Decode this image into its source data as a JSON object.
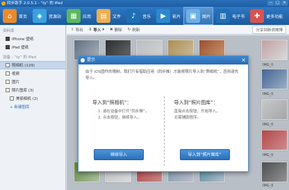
{
  "window": {
    "title": "同步助手 2.0.5.1 - “ty” 的 iPad",
    "buttons": [
      "—",
      "□",
      "✕"
    ]
  },
  "nav": {
    "items": [
      {
        "label": "首页",
        "icon": "home-icon",
        "color": "#e98a2e"
      },
      {
        "label": "资源站",
        "icon": "resource-icon",
        "color": "#3aa0e0"
      },
      {
        "label": "应用",
        "icon": "app-icon",
        "color": "#5cb85c"
      },
      {
        "label": "文件",
        "icon": "file-icon",
        "color": "#f0ad4e"
      },
      {
        "label": "音乐",
        "icon": "music-icon",
        "color": "#1f6fb5"
      },
      {
        "label": "影片",
        "icon": "video-icon",
        "color": "#2c89cf"
      },
      {
        "label": "图片",
        "icon": "picture-icon",
        "color": "#6bb0e6",
        "active": true
      },
      {
        "label": "电子书",
        "icon": "ebook-icon",
        "color": "#1f6fb5"
      },
      {
        "label": "更多功能",
        "icon": "more-icon",
        "color": "#d9534f"
      }
    ]
  },
  "sidebar": {
    "local_heading": "资料库",
    "local_items": [
      {
        "label": "iPhone 壁纸"
      },
      {
        "label": "iPad 壁纸"
      }
    ],
    "device_heading": "设备 - “ty” 的 iPad",
    "device_items": [
      {
        "label": "照相机 (129)",
        "selected": true
      },
      {
        "label": "视频"
      },
      {
        "label": "图片"
      },
      {
        "label": "照片图库 (3)"
      },
      {
        "label": "美丽相机 (2)",
        "sub": true
      },
      {
        "label": "+ 新建图库",
        "link": true,
        "sub": true
      }
    ]
  },
  "toolbar": {
    "export": "导出",
    "import": "导入",
    "delete": "删除",
    "refresh": "刷新",
    "share": "分享到新浪微博"
  },
  "gallery": {
    "labels": [
      "IMG_0",
      "IMG_0",
      "IMG_0",
      "IMG_0",
      "IMG_0"
    ]
  },
  "modal": {
    "title": "提示",
    "description": "由于 iOS固件的限制，我们只有借助应用（同步推）才能将照片导入到“照相机”，否则请先导入。",
    "left": {
      "heading": "导入到“照相机”：",
      "steps": [
        "1. 请在设备中打开“同步推”。",
        "2. 点击按钮，继续导入。"
      ],
      "button": "继续导入"
    },
    "right": {
      "heading": "导入到“照片图库”：",
      "steps": [
        "直接点击按钮，开始导入。",
        "无需辅助程序。"
      ],
      "button": "导入到“照片图库”"
    }
  }
}
